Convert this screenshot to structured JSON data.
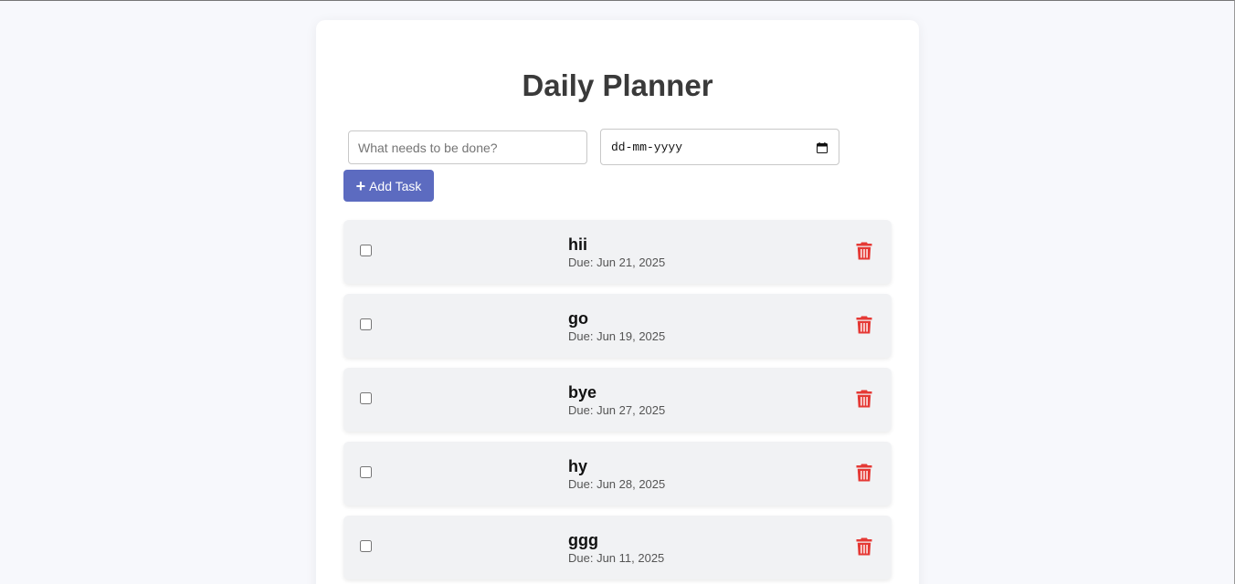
{
  "app": {
    "title": "Daily Planner"
  },
  "form": {
    "task_placeholder": "What needs to be done?",
    "task_value": "",
    "date_placeholder": "dd-mm-yyyy",
    "add_label": "Add Task",
    "add_icon": "plus-icon",
    "date_icon": "calendar-icon"
  },
  "tasks": [
    {
      "name": "hii",
      "due": "Due: Jun 21, 2025",
      "done": false
    },
    {
      "name": "go",
      "due": "Due: Jun 19, 2025",
      "done": false
    },
    {
      "name": "bye",
      "due": "Due: Jun 27, 2025",
      "done": false
    },
    {
      "name": "hy",
      "due": "Due: Jun 28, 2025",
      "done": false
    },
    {
      "name": "ggg",
      "due": "Due: Jun 11, 2025",
      "done": false
    }
  ],
  "colors": {
    "accent": "#5c6bc0",
    "delete": "#e53935",
    "background": "#f7f8fc",
    "item_background": "#f1f2f4"
  },
  "icons": {
    "delete": "trash-icon"
  }
}
